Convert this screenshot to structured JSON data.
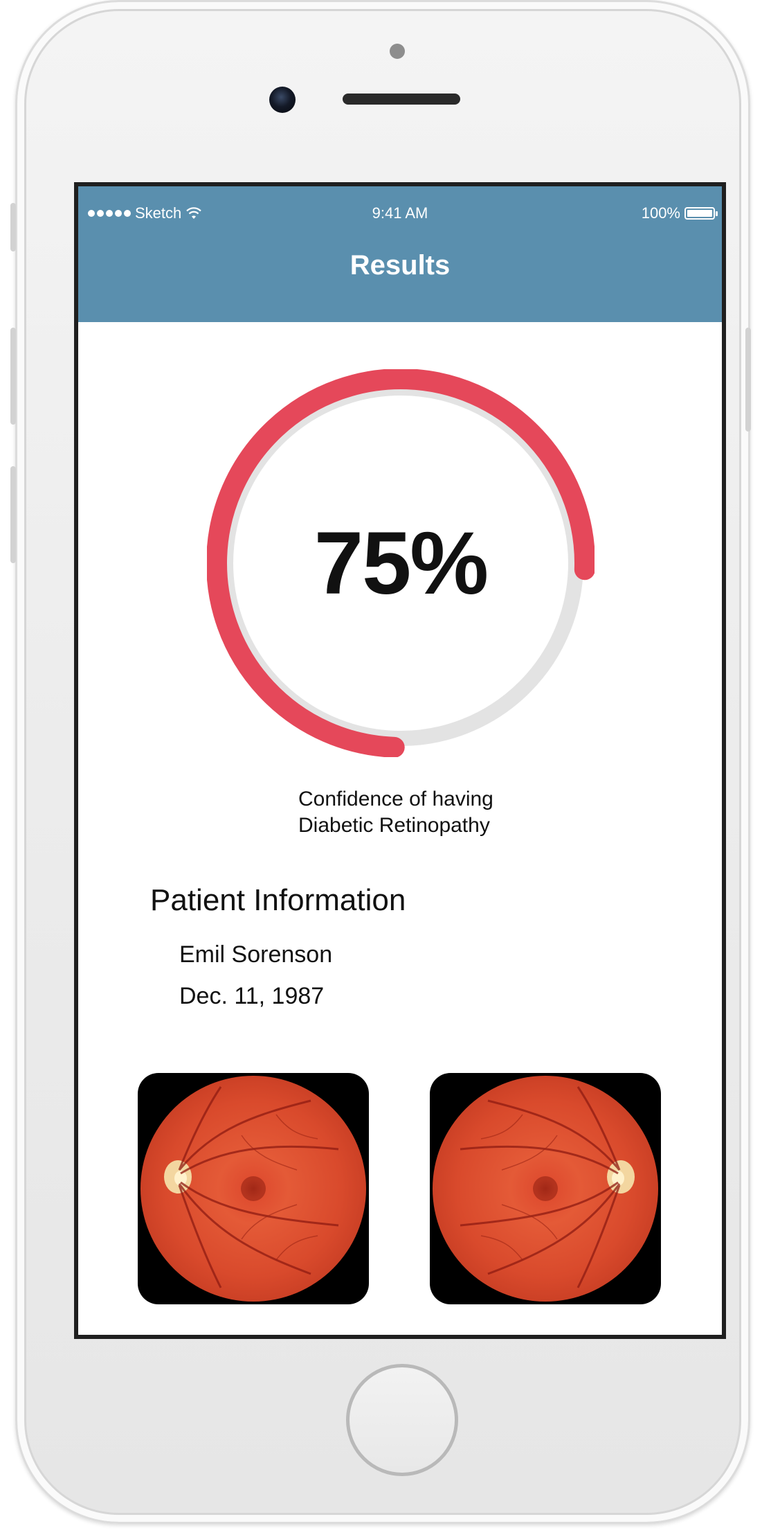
{
  "status_bar": {
    "carrier": "Sketch",
    "time": "9:41 AM",
    "battery": "100%"
  },
  "header": {
    "title": "Results"
  },
  "result": {
    "percent_label": "75%",
    "percent_value": 75,
    "caption_line1": "Confidence of having",
    "caption_line2": "Diabetic Retinopathy",
    "colors": {
      "progress": "#e5485a",
      "track": "#e3e3e3",
      "header": "#5a8fae"
    }
  },
  "patient": {
    "heading": "Patient Information",
    "name": "Emil Sorenson",
    "dob": "Dec. 11, 1987"
  },
  "images": [
    {
      "name": "left-eye-fundus",
      "disc_side": "left"
    },
    {
      "name": "right-eye-fundus",
      "disc_side": "right"
    }
  ]
}
